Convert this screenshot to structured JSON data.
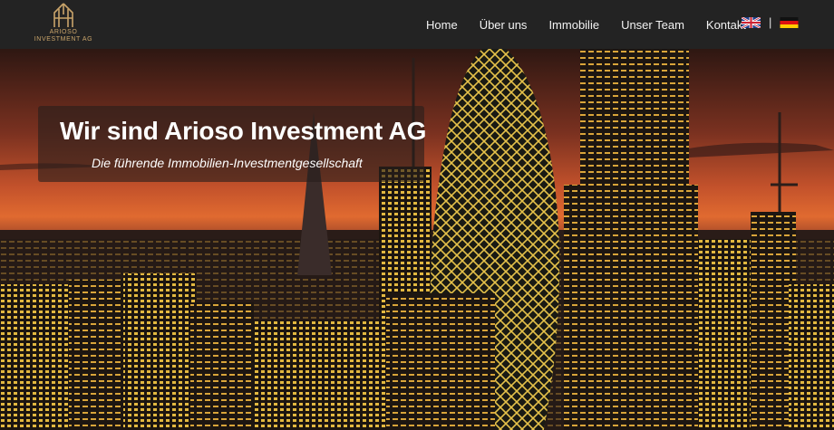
{
  "brand": {
    "name_line1": "ARIOSO",
    "name_line2": "INVESTMENT AG",
    "gold": "#c9a46a"
  },
  "nav": {
    "items": [
      {
        "label": "Home"
      },
      {
        "label": "Über uns"
      },
      {
        "label": "Immobilie"
      },
      {
        "label": "Unser Team"
      },
      {
        "label": "Kontakt"
      }
    ],
    "languages": [
      {
        "code": "en",
        "icon": "uk-flag-icon"
      },
      {
        "code": "de",
        "icon": "german-flag-icon"
      }
    ],
    "separator": "|"
  },
  "hero": {
    "title": "Wir sind Arioso Investment AG",
    "subtitle": "Die führende Immobilien-Investmentgesellschaft",
    "background": "london-skyline-sunset-image"
  }
}
